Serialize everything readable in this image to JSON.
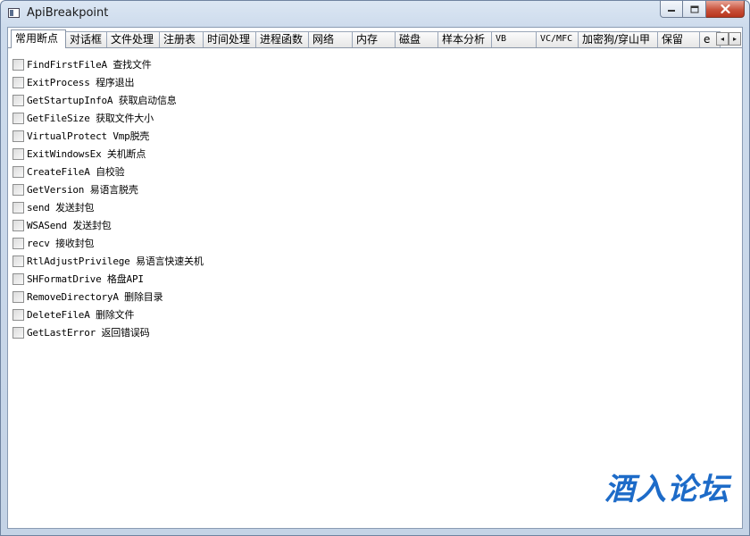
{
  "window": {
    "title": "ApiBreakpoint"
  },
  "tabs": [
    {
      "label": "常用断点",
      "active": true
    },
    {
      "label": "对话框"
    },
    {
      "label": "文件处理"
    },
    {
      "label": "注册表"
    },
    {
      "label": "时间处理"
    },
    {
      "label": "进程函数"
    },
    {
      "label": "网络"
    },
    {
      "label": "内存"
    },
    {
      "label": "磁盘"
    },
    {
      "label": "样本分析"
    },
    {
      "label": "VB"
    },
    {
      "label": "VC/MFC"
    },
    {
      "label": "加密狗/穿山甲"
    },
    {
      "label": "保留"
    },
    {
      "label": "e"
    }
  ],
  "tab_scroll": {
    "left": "◂",
    "right": "▸"
  },
  "breakpoints": [
    {
      "label": "FindFirstFileA 查找文件",
      "checked": false
    },
    {
      "label": "ExitProcess 程序退出",
      "checked": false
    },
    {
      "label": "GetStartupInfoA 获取启动信息",
      "checked": false
    },
    {
      "label": "GetFileSize 获取文件大小",
      "checked": false
    },
    {
      "label": "VirtualProtect Vmp脱壳",
      "checked": false
    },
    {
      "label": "ExitWindowsEx 关机断点",
      "checked": false
    },
    {
      "label": "CreateFileA 自校验",
      "checked": false
    },
    {
      "label": "GetVersion 易语言脱壳",
      "checked": false
    },
    {
      "label": "send 发送封包",
      "checked": false
    },
    {
      "label": "WSASend 发送封包",
      "checked": false
    },
    {
      "label": "recv 接收封包",
      "checked": false
    },
    {
      "label": "RtlAdjustPrivilege 易语言快速关机",
      "checked": false
    },
    {
      "label": "SHFormatDrive 格盘API",
      "checked": false
    },
    {
      "label": "RemoveDirectoryA 删除目录",
      "checked": false
    },
    {
      "label": "DeleteFileA 删除文件",
      "checked": false
    },
    {
      "label": "GetLastError 返回错误码",
      "checked": false
    }
  ],
  "watermark": "酒入论坛",
  "colors": {
    "watermark": "#1d6bc8",
    "close_button": "#c8523b"
  }
}
